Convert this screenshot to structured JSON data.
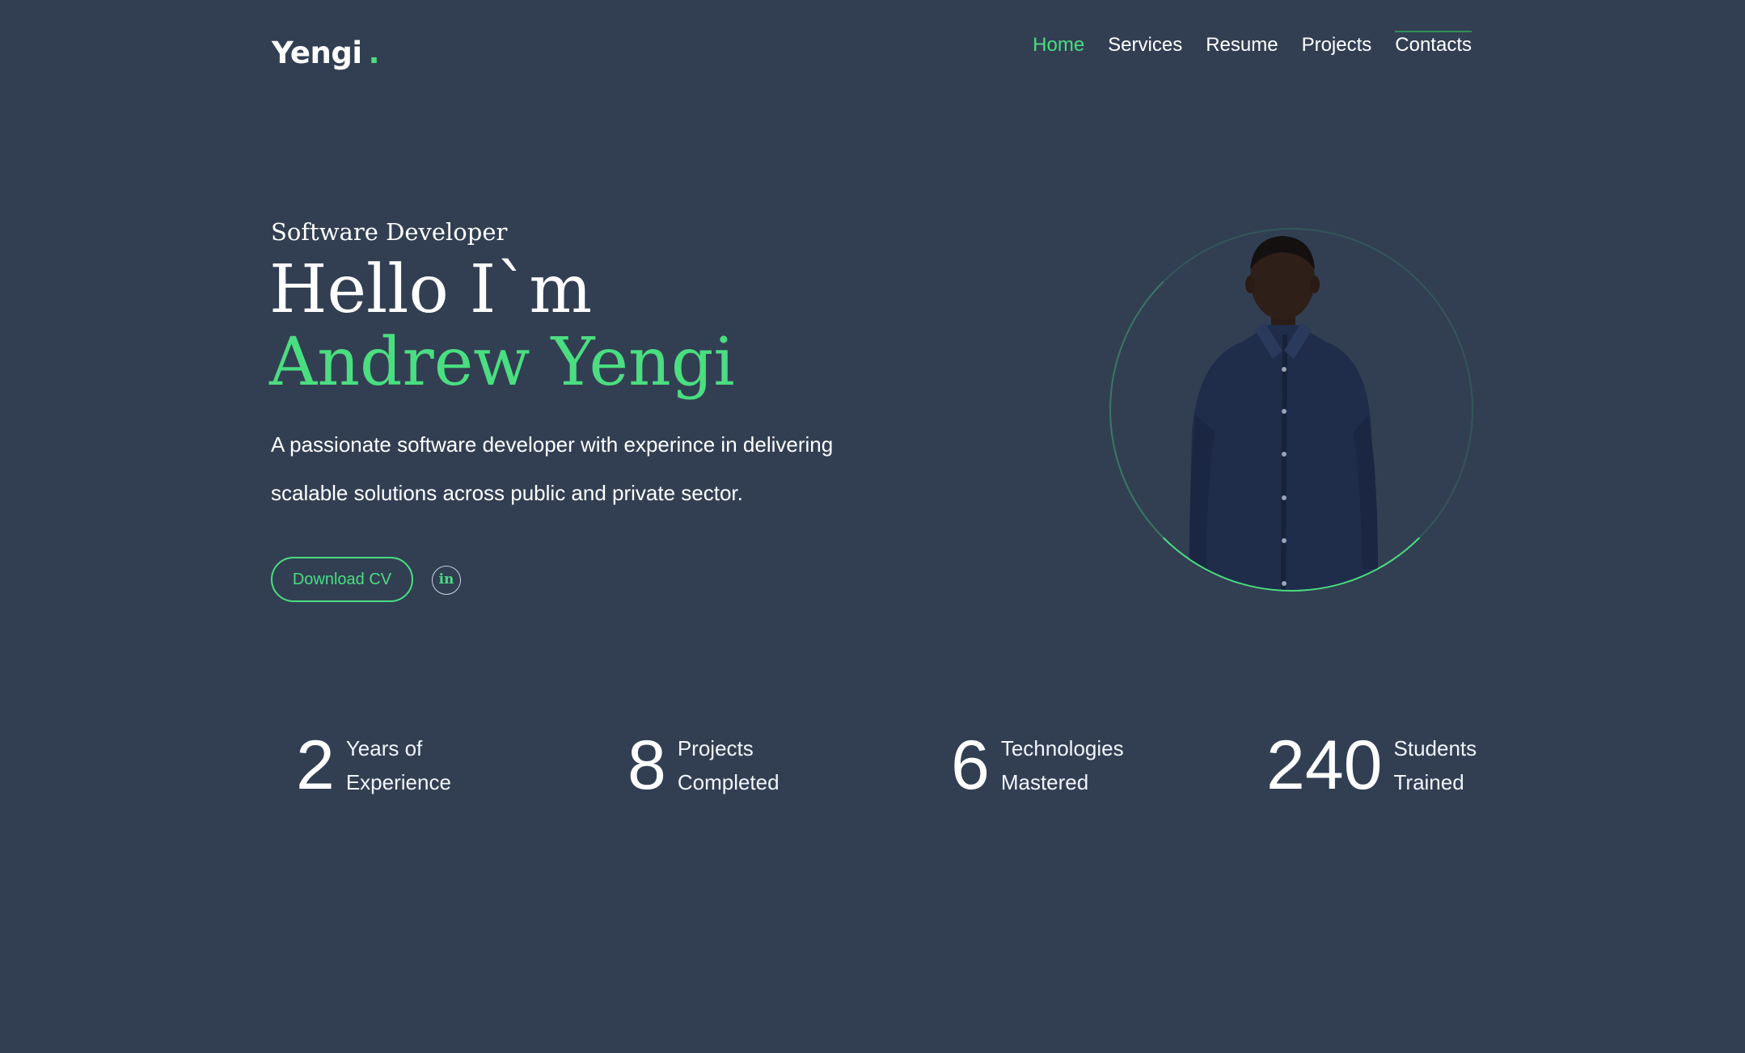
{
  "header": {
    "logo_text": "Yengi",
    "logo_dot": ".",
    "nav": [
      {
        "label": "Home"
      },
      {
        "label": "Services"
      },
      {
        "label": "Resume"
      },
      {
        "label": "Projects"
      },
      {
        "label": "Contacts"
      }
    ]
  },
  "hero": {
    "role": "Software Developer",
    "greeting": "Hello I`m",
    "name": "Andrew Yengi",
    "description_line1": "A passionate software developer with experince in delivering",
    "description_line2": "scalable solutions across public and private sector.",
    "download_label": "Download CV",
    "linkedin_glyph": "in",
    "photo_icon": "profile-photo"
  },
  "stats": [
    {
      "number": "2",
      "line1": "Years of",
      "line2": "Experience"
    },
    {
      "number": "8",
      "line1": "Projects",
      "line2": "Completed"
    },
    {
      "number": "6",
      "line1": "Technologies",
      "line2": "Mastered"
    },
    {
      "number": "240",
      "line1": "Students",
      "line2": "Trained"
    }
  ],
  "colors": {
    "background": "#323f53",
    "accent": "#4ade80",
    "text": "#ffffff"
  }
}
